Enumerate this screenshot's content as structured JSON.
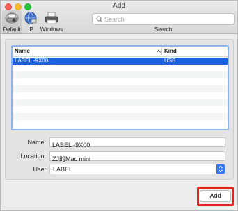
{
  "window": {
    "title": "Add"
  },
  "toolbar": {
    "items": [
      {
        "label": "Default",
        "icon": "printer-icon",
        "selected": true
      },
      {
        "label": "IP",
        "icon": "globe-icon"
      },
      {
        "label": "Windows",
        "icon": "windows-printer-icon"
      }
    ],
    "search_placeholder": "Search",
    "search_label": "Search"
  },
  "printer_list": {
    "columns": [
      "Name",
      "Kind"
    ],
    "rows": [
      {
        "name": "LABEL -9X00",
        "kind": "USB",
        "selected": true
      }
    ]
  },
  "form": {
    "name_label": "Name:",
    "name_value": "LABEL -9X00",
    "location_label": "Location:",
    "location_value": "ZJ的Mac mini",
    "use_label": "Use:",
    "use_value": "LABEL"
  },
  "actions": {
    "add_label": "Add"
  },
  "colors": {
    "selection": "#1e63d6",
    "list_border": "#8fb4ea",
    "highlight": "#e4251f",
    "stepper": "#3478f6"
  }
}
